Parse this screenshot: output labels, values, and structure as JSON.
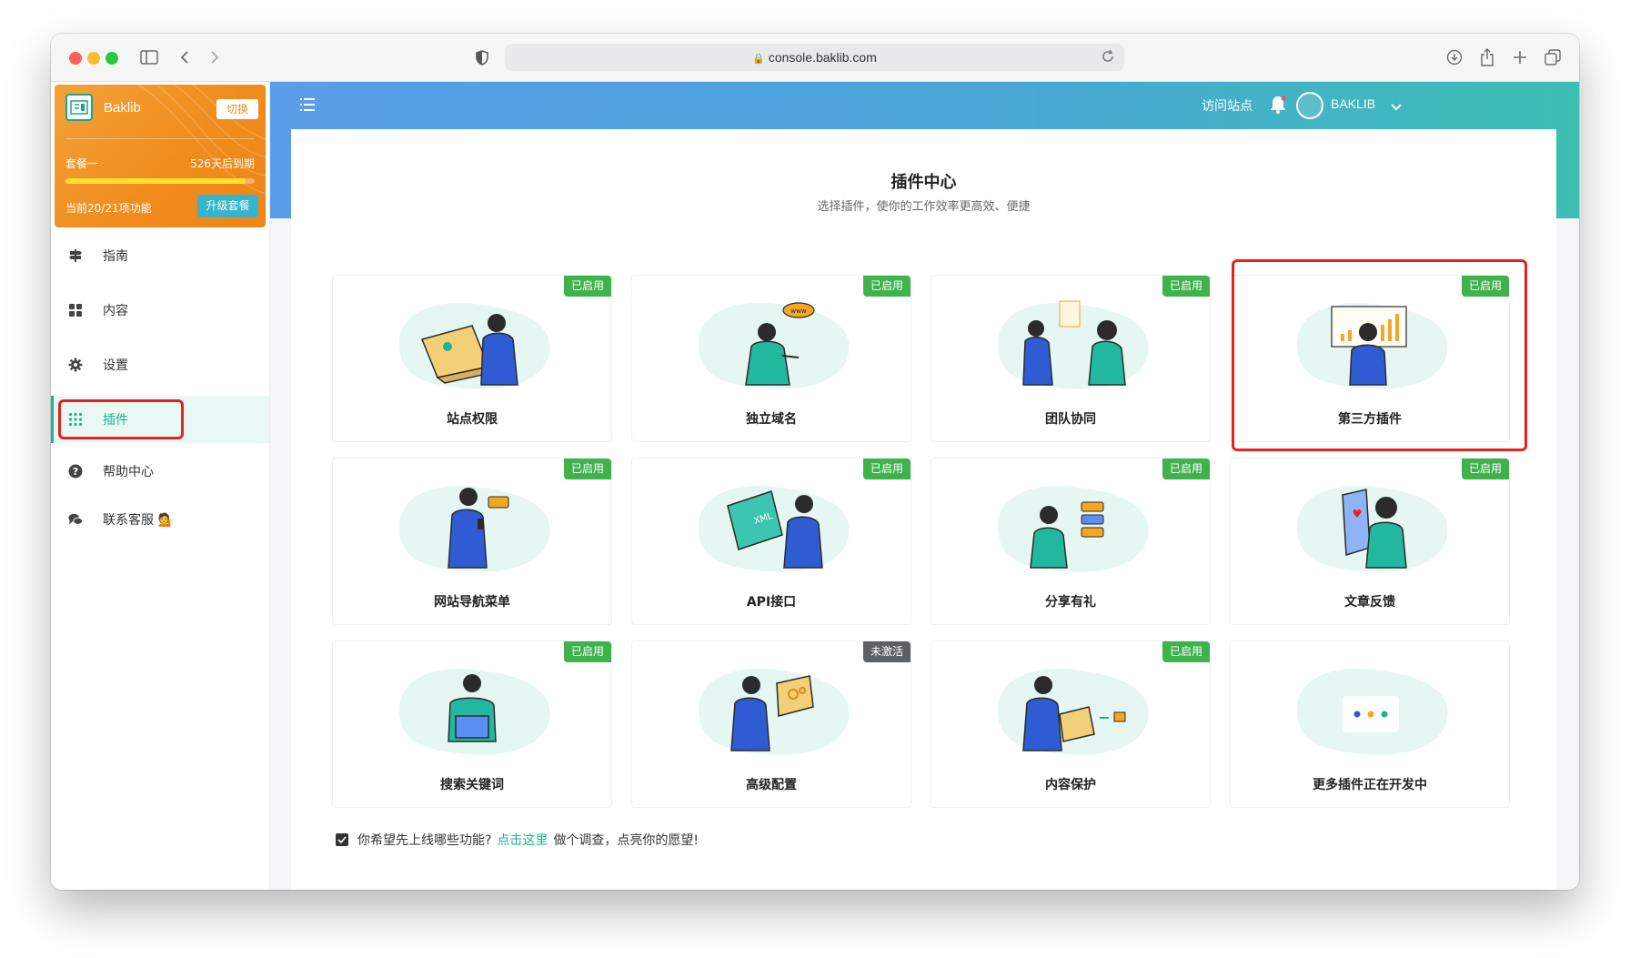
{
  "browser": {
    "url": "console.baklib.com"
  },
  "brand": {
    "name": "Baklib",
    "switch_label": "切换",
    "plan_name": "套餐一",
    "expiry": "526天后到期",
    "usage_fraction": 0.95,
    "feature_count": "当前20/21项功能",
    "upgrade_label": "升级套餐"
  },
  "sidebar": {
    "items": [
      {
        "label": "指南",
        "icon": "signpost-icon"
      },
      {
        "label": "内容",
        "icon": "grid-icon"
      },
      {
        "label": "设置",
        "icon": "gear-icon"
      },
      {
        "label": "插件",
        "icon": "dots-grid-icon",
        "active": true
      },
      {
        "label": "帮助中心",
        "icon": "question-icon"
      },
      {
        "label": "联系客服 💁",
        "icon": "chat-icon"
      }
    ]
  },
  "topbar": {
    "visit_site": "访问站点",
    "user_name": "BAKLIB"
  },
  "main": {
    "title": "插件中心",
    "subtitle": "选择插件，使你的工作效率更高效、便捷",
    "plugins": [
      {
        "name": "站点权限",
        "status": "已启用"
      },
      {
        "name": "独立域名",
        "status": "已启用"
      },
      {
        "name": "团队协同",
        "status": "已启用"
      },
      {
        "name": "第三方插件",
        "status": "已启用"
      },
      {
        "name": "网站导航菜单",
        "status": "已启用"
      },
      {
        "name": "API接口",
        "status": "已启用"
      },
      {
        "name": "分享有礼",
        "status": "已启用"
      },
      {
        "name": "文章反馈",
        "status": "已启用"
      },
      {
        "name": "搜索关键词",
        "status": "已启用"
      },
      {
        "name": "高级配置",
        "status": "未激活"
      },
      {
        "name": "内容保护",
        "status": "已启用"
      },
      {
        "name": "更多插件正在开发中",
        "status": ""
      }
    ],
    "survey": {
      "prefix": "你希望先上线哪些功能?",
      "link": "点击这里",
      "suffix": "做个调查，点亮你的愿望!"
    }
  },
  "colors": {
    "accent": "#1ab394",
    "brand_orange": "#f08c1e",
    "badge_enabled": "#3fb24c",
    "badge_inactive": "#5b6066",
    "highlight_red": "#e5231b"
  }
}
